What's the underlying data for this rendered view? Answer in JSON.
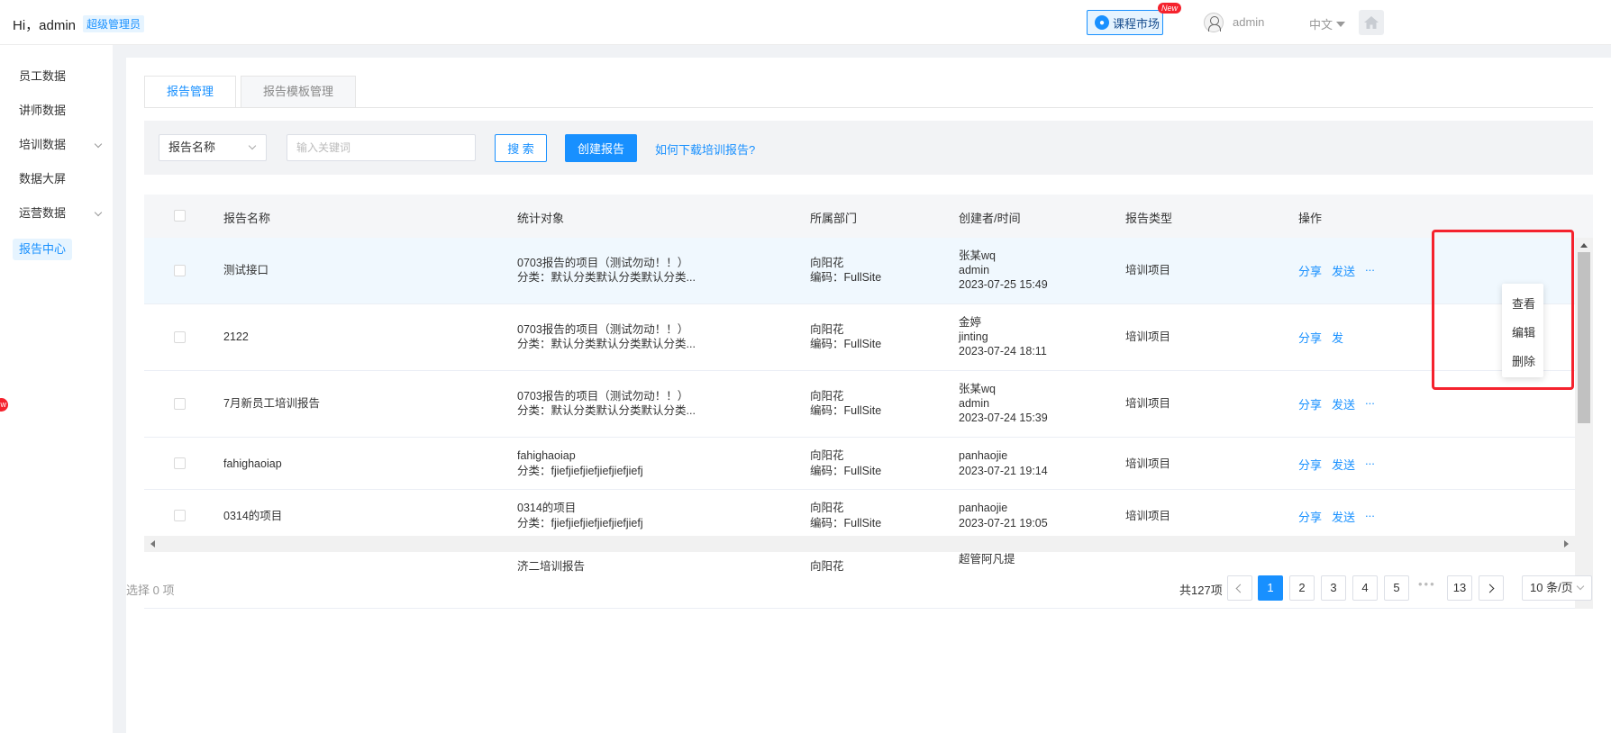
{
  "header": {
    "greeting": "Hi，admin",
    "role": "超级管理员",
    "market_label": "课程市场",
    "new_tag": "New",
    "user_name": "admin",
    "language": "中文"
  },
  "sidebar": {
    "items": [
      {
        "label": "员工数据"
      },
      {
        "label": "讲师数据"
      },
      {
        "label": "培训数据"
      },
      {
        "label": "数据大屏"
      },
      {
        "label": "运营数据"
      },
      {
        "label": "报告中心"
      }
    ],
    "badge": "w"
  },
  "tabs": [
    {
      "label": "报告管理"
    },
    {
      "label": "报告模板管理"
    }
  ],
  "filter": {
    "select_value": "报告名称",
    "search_placeholder": "输入关键词",
    "search_label": "搜 索",
    "create_label": "创建报告",
    "help_link": "如何下载培训报告?"
  },
  "table": {
    "columns": [
      "报告名称",
      "统计对象",
      "所属部门",
      "创建者/时间",
      "报告类型",
      "操作"
    ],
    "rows": [
      {
        "name": "测试接口",
        "target1": "0703报告的项目（测试勿动！！）",
        "target2": "分类：默认分类默认分类默认分类...",
        "dept1": "向阳花",
        "dept2": "编码：FullSite",
        "creator1": "张某wq",
        "creator2": "admin",
        "time": "2023-07-25 15:49",
        "type": "培训项目",
        "op_share": "分享",
        "op_send": "发送",
        "op_more": "..."
      },
      {
        "name": "2122",
        "target1": "0703报告的项目（测试勿动！！）",
        "target2": "分类：默认分类默认分类默认分类...",
        "dept1": "向阳花",
        "dept2": "编码：FullSite",
        "creator1": "金婷",
        "creator2": "jinting",
        "time": "2023-07-24 18:11",
        "type": "培训项目",
        "op_share": "分享",
        "op_send": "发",
        "op_more": ""
      },
      {
        "name": "7月新员工培训报告",
        "target1": "0703报告的项目（测试勿动！！）",
        "target2": "分类：默认分类默认分类默认分类...",
        "dept1": "向阳花",
        "dept2": "编码：FullSite",
        "creator1": "张某wq",
        "creator2": "admin",
        "time": "2023-07-24 15:39",
        "type": "培训项目",
        "op_share": "分享",
        "op_send": "发送",
        "op_more": "..."
      },
      {
        "name": "fahighaoiap",
        "target1": "fahighaoiap",
        "target2": "分类：fjiefjiefjiefjiefjiefjiefj",
        "dept1": "向阳花",
        "dept2": "编码：FullSite",
        "creator1": "panhaojie",
        "creator2": "",
        "time": "2023-07-21 19:14",
        "type": "培训项目",
        "op_share": "分享",
        "op_send": "发送",
        "op_more": "..."
      },
      {
        "name": "0314的项目",
        "target1": "0314的项目",
        "target2": "分类：fjiefjiefjiefjiefjiefjiefj",
        "dept1": "向阳花",
        "dept2": "编码：FullSite",
        "creator1": "panhaojie",
        "creator2": "",
        "time": "2023-07-21 19:05",
        "type": "培训项目",
        "op_share": "分享",
        "op_send": "发送",
        "op_more": "..."
      },
      {
        "name": "",
        "target1": "济二培训报告",
        "target2": "",
        "dept1": "向阳花",
        "dept2": "",
        "creator1": "超管阿凡提",
        "creator2": "",
        "time": "",
        "type": "",
        "op_share": "",
        "op_send": "",
        "op_more": ""
      }
    ]
  },
  "dropdown": {
    "items": [
      "查看",
      "编辑",
      "删除"
    ]
  },
  "footer": {
    "selected": "选择 0 项",
    "total": "共127项",
    "pages": [
      "1",
      "2",
      "3",
      "4",
      "5",
      "13"
    ],
    "ellipsis": "•••",
    "page_size": "10 条/页"
  }
}
